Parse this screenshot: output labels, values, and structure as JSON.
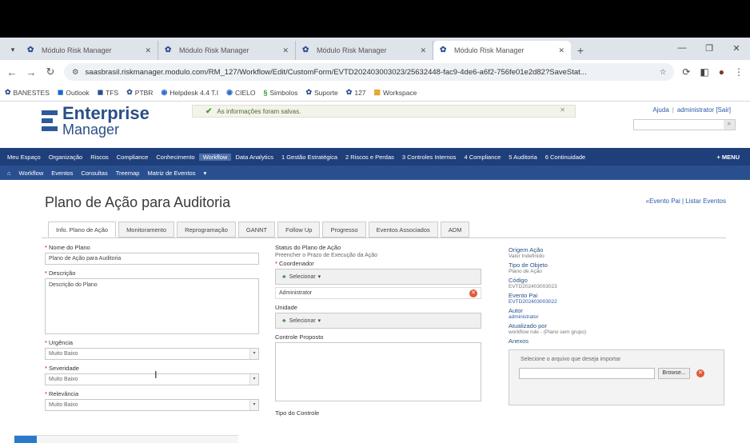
{
  "browser": {
    "tabs": [
      {
        "label": "Módulo Risk Manager"
      },
      {
        "label": "Módulo Risk Manager"
      },
      {
        "label": "Módulo Risk Manager"
      },
      {
        "label": "Módulo Risk Manager"
      }
    ],
    "url": "saasbrasil.riskmanager.modulo.com/RM_127/Workflow/Edit/CustomForm/EVTD202403003023/25632448-fac9-4de6-a6f2-756fe01e2d82?SaveStat...",
    "bookmarks": [
      "BANESTES",
      "Outlook",
      "TFS",
      "PTBR",
      "Helpdesk 4.4 T.I",
      "CIELO",
      "Simbolos",
      "Suporte",
      "127",
      "Workspace"
    ]
  },
  "header": {
    "logo_line1": "Enterprise",
    "logo_line2": "Manager",
    "notice": "As informações foram salvas.",
    "help_link": "Ajuda",
    "user_link": "administrator [Sair]"
  },
  "nav": {
    "main": [
      "Meu Espaço",
      "Organização",
      "Riscos",
      "Compliance",
      "Conhecimento",
      "Workflow",
      "Data Analytics",
      "1 Gestão Estratégica",
      "2 Riscos e Perdas",
      "3 Controles Internos",
      "4 Compliance",
      "5 Auditoria",
      "6 Continuidade"
    ],
    "menu": "+ MENU",
    "sub": [
      "Workflow",
      "Eventos",
      "Consultas",
      "Treemap",
      "Matriz de Eventos"
    ]
  },
  "page": {
    "title": "Plano de Ação para Auditoria",
    "back_links": "«Evento Pai | Listar Eventos",
    "tabs": [
      "Info. Plano de Ação",
      "Monitoramento",
      "Reprogramação",
      "GANNT",
      "Follow Up",
      "Progresso",
      "Eventos Associados",
      "ADM"
    ]
  },
  "form": {
    "nome_label": "Nome do Plano",
    "nome_value": "Plano de Ação para Auditoria",
    "descricao_label": "Descrição",
    "descricao_value": "Descrição do Plano",
    "urgencia_label": "Urgência",
    "urgencia_value": "Muito Baixo",
    "severidade_label": "Severidade",
    "severidade_value": "Muito Baixo",
    "relevancia_label": "Relevância",
    "relevancia_value": "Muito Baixo",
    "status_label": "Status do Plano de Ação",
    "status_sub": "Preencher o Prazo de Execução da Ação",
    "coordenador_label": "Coordenador",
    "selecionar": "Selecionar",
    "coordenador_value": "Administrator",
    "unidade_label": "Unidade",
    "controle_label": "Controle Proposto",
    "tipo_controle_label": "Tipo do Controle"
  },
  "right": {
    "origem_label": "Origem Ação",
    "origem_value": "Valor Indefinido",
    "tipo_label": "Tipo de Objeto",
    "tipo_value": "Plano de Ação",
    "codigo_label": "Código",
    "codigo_value": "EVTD202403003023",
    "evento_label": "Evento Pai",
    "evento_value": "EVTD202403003022",
    "autor_label": "Autor",
    "autor_value": "administrator",
    "atualizado_label": "Atualizado por",
    "atualizado_value": "workflow rule - (Plano sem grupo)",
    "anexos_label": "Anexos",
    "anexos_hint": "Selecione o arquivo que deseja importar",
    "browse": "Browse..."
  }
}
